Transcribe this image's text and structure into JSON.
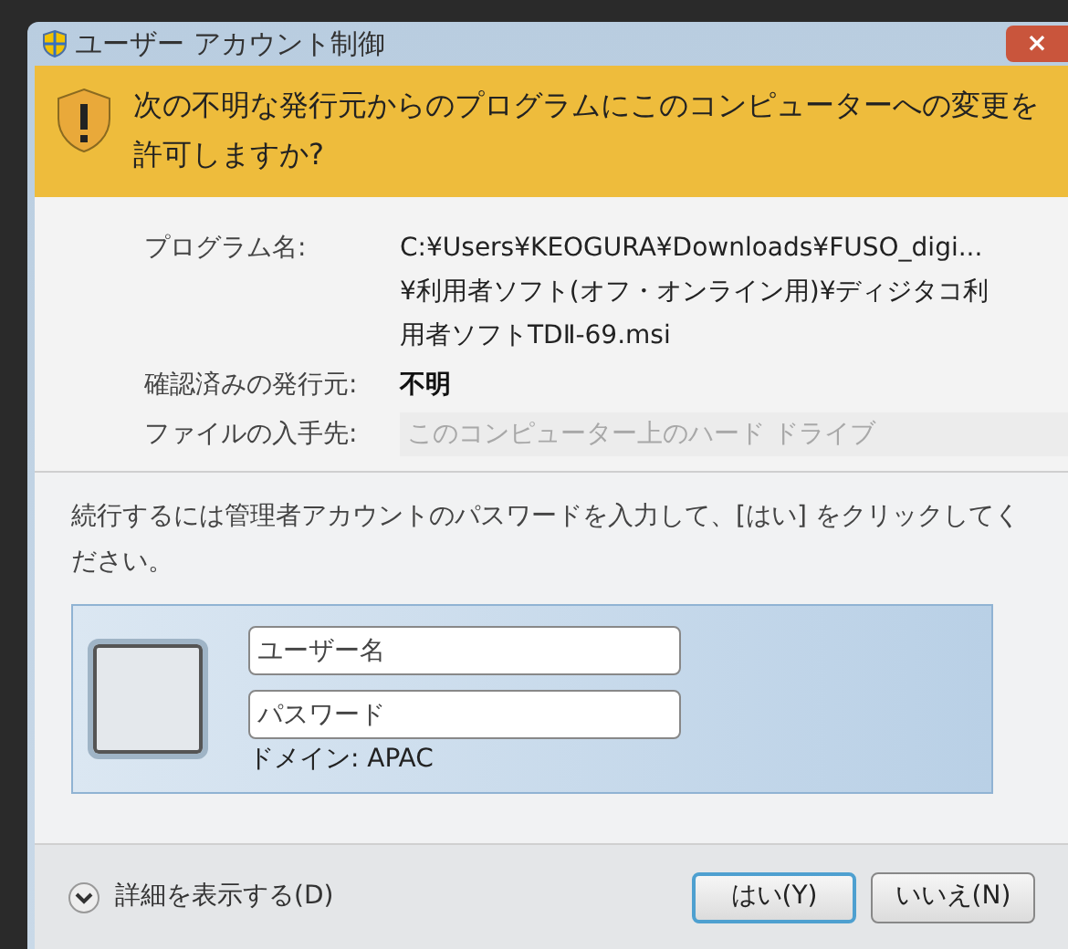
{
  "window": {
    "title": "ユーザー アカウント制御",
    "close": "×"
  },
  "banner": {
    "message": "次の不明な発行元からのプログラムにこのコンピューターへの変更を許可しますか?"
  },
  "details": [
    {
      "label": "プログラム名:",
      "value": "C:¥Users¥KEOGURA¥Downloads¥FUSO_digi...¥利用者ソフト(オフ・オンライン用)¥ディジタコ利用者ソフトTDⅡ-69.msi",
      "kind": "plain"
    },
    {
      "label": "確認済みの発行元:",
      "value": "不明",
      "kind": "bold"
    },
    {
      "label": "ファイルの入手先:",
      "value": "このコンピューター上のハード ドライブ",
      "kind": "faint"
    }
  ],
  "instruction": "続行するには管理者アカウントのパスワードを入力して、[はい] をクリックしてください。",
  "credentials": {
    "username": {
      "placeholder": "ユーザー名"
    },
    "password": {
      "placeholder": "パスワード"
    },
    "domain": "ドメイン: APAC"
  },
  "footer": {
    "details_toggle": "詳細を表示する(D)",
    "buttons": [
      {
        "label": "はい(Y)",
        "default": true
      },
      {
        "label": "いいえ(N)",
        "default": false
      }
    ]
  }
}
